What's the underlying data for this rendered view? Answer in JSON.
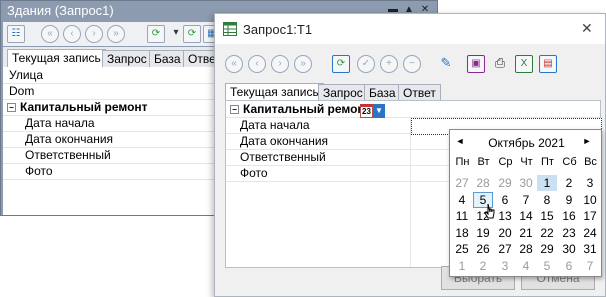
{
  "back_window": {
    "title": "Здания (Запрос1)",
    "tabs": [
      "Текущая запись",
      "Запрос",
      "База",
      "Ответ"
    ],
    "rows": [
      {
        "label": "Улица",
        "bold": false
      },
      {
        "label": "Dom",
        "bold": false
      },
      {
        "label": "Капитальный ремонт",
        "bold": true,
        "group": true
      },
      {
        "label": "Дата начала",
        "bold": false
      },
      {
        "label": "Дата окончания",
        "bold": false
      },
      {
        "label": "Ответственный",
        "bold": false
      },
      {
        "label": "Фото",
        "bold": false
      }
    ]
  },
  "front_window": {
    "title": "Запрос1:T1",
    "tabs": [
      "Текущая запись",
      "Запрос",
      "База",
      "Ответ"
    ],
    "group_label": "Капитальный ремонт",
    "rows": [
      {
        "label": "Дата начала"
      },
      {
        "label": "Дата окончания"
      },
      {
        "label": "Ответственный"
      },
      {
        "label": "Фото"
      }
    ],
    "calendar_icon_text": "23",
    "buttons": {
      "select": "Выбрать",
      "cancel": "Отмена"
    },
    "accent_color": "#2a74c8"
  },
  "calendar": {
    "month": "Октябрь 2021",
    "weekdays": [
      "Пн",
      "Вт",
      "Ср",
      "Чт",
      "Пт",
      "Сб",
      "Вс"
    ],
    "weeks": [
      [
        "27",
        "28",
        "29",
        "30",
        "1",
        "2",
        "3"
      ],
      [
        "4",
        "5",
        "6",
        "7",
        "8",
        "9",
        "10"
      ],
      [
        "11",
        "12",
        "13",
        "14",
        "15",
        "16",
        "17"
      ],
      [
        "18",
        "19",
        "20",
        "21",
        "22",
        "23",
        "24"
      ],
      [
        "25",
        "26",
        "27",
        "28",
        "29",
        "30",
        "31"
      ],
      [
        "1",
        "2",
        "3",
        "4",
        "5",
        "6",
        "7"
      ]
    ],
    "muted_weeks": [
      0,
      5
    ],
    "muted_days_week0": [
      0,
      1,
      2,
      3
    ],
    "today": "1",
    "hovered": "5",
    "prev_icon": "◄",
    "next_icon": "►"
  }
}
